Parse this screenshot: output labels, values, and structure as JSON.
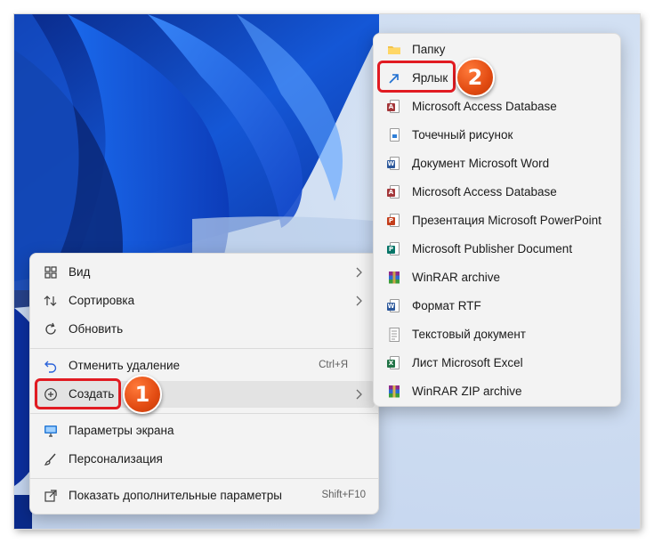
{
  "main_menu": {
    "items": [
      {
        "label": "Вид",
        "icon": "grid-view-icon",
        "submenu": true
      },
      {
        "label": "Сортировка",
        "icon": "sort-icon",
        "submenu": true
      },
      {
        "label": "Обновить",
        "icon": "refresh-icon"
      },
      {
        "label": "Отменить удаление",
        "icon": "undo-icon",
        "shortcut": "Ctrl+Я"
      },
      {
        "label": "Создать",
        "icon": "plus-circle-icon",
        "submenu": true
      },
      {
        "label": "Параметры экрана",
        "icon": "display-settings-icon"
      },
      {
        "label": "Персонализация",
        "icon": "brush-icon"
      },
      {
        "label": "Показать дополнительные параметры",
        "icon": "expand-icon",
        "shortcut": "Shift+F10"
      }
    ]
  },
  "sub_menu": {
    "items": [
      {
        "label": "Папку",
        "icon": "folder-icon"
      },
      {
        "label": "Ярлык",
        "icon": "shortcut-arrow-icon"
      },
      {
        "label": "Microsoft Access Database",
        "icon": "access-icon"
      },
      {
        "label": "Точечный рисунок",
        "icon": "bitmap-icon"
      },
      {
        "label": "Документ Microsoft Word",
        "icon": "word-icon"
      },
      {
        "label": "Microsoft Access Database",
        "icon": "access-icon"
      },
      {
        "label": "Презентация Microsoft PowerPoint",
        "icon": "powerpoint-icon"
      },
      {
        "label": "Microsoft Publisher Document",
        "icon": "publisher-icon"
      },
      {
        "label": "WinRAR archive",
        "icon": "winrar-icon"
      },
      {
        "label": "Формат RTF",
        "icon": "rtf-icon"
      },
      {
        "label": "Текстовый документ",
        "icon": "text-document-icon"
      },
      {
        "label": "Лист Microsoft Excel",
        "icon": "excel-icon"
      },
      {
        "label": "WinRAR ZIP archive",
        "icon": "winrar-zip-icon"
      }
    ]
  },
  "annotations": [
    {
      "number": "1",
      "target": "Создать"
    },
    {
      "number": "2",
      "target": "Ярлык"
    }
  ],
  "colors": {
    "highlight": "#e11b22",
    "marker": "#e24b12",
    "menu_background": "#f3f3f3"
  }
}
